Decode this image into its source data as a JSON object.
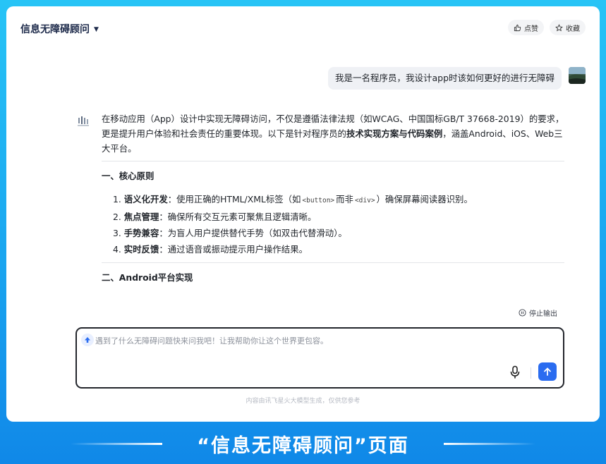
{
  "header": {
    "title": "信息无障碍顾问",
    "like_label": "点赞",
    "favorite_label": "收藏"
  },
  "chat": {
    "user_message": "我是一名程序员，我设计app时该如何更好的进行无障碍",
    "answer": {
      "intro_1": "在移动应用（App）设计中实现无障碍访问，不仅是遵循法律法规（如WCAG、中国国标GB/T 37668-2019）的要求，更是提升用户体验和社会责任的重要体现。以下是针对程序员的",
      "intro_bold": "技术实现方案与代码案例",
      "intro_2": "，涵盖Android、iOS、Web三大平台。",
      "section_1_title": "一、核心原则",
      "principles": [
        {
          "num": "1.",
          "term": "语义化开发",
          "text_a": "：使用正确的HTML/XML标签（如",
          "code_a": "<button>",
          "text_b": "而非",
          "code_b": "<div>",
          "text_c": "）确保屏幕阅读器识别。"
        },
        {
          "num": "2.",
          "term": "焦点管理",
          "text_a": "：确保所有交互元素可聚焦且逻辑清晰。"
        },
        {
          "num": "3.",
          "term": "手势兼容",
          "text_a": "：为盲人用户提供替代手势（如双击代替滑动）。"
        },
        {
          "num": "4.",
          "term": "实时反馈",
          "text_a": "：通过语音或振动提示用户操作结果。"
        }
      ],
      "section_2_title": "二、Android平台实现"
    },
    "stop_label": "停止输出"
  },
  "input": {
    "placeholder": "遇到了什么无障碍问题快来问我吧！让我帮助你让这个世界更包容。",
    "value": ""
  },
  "footnote": "内容由讯飞星火大模型生成，仅供您参考",
  "caption": "“信息无障碍顾问”页面",
  "colors": {
    "accent": "#2a6cf0",
    "background_top": "#27c4f6",
    "background_bottom": "#1088e8"
  }
}
